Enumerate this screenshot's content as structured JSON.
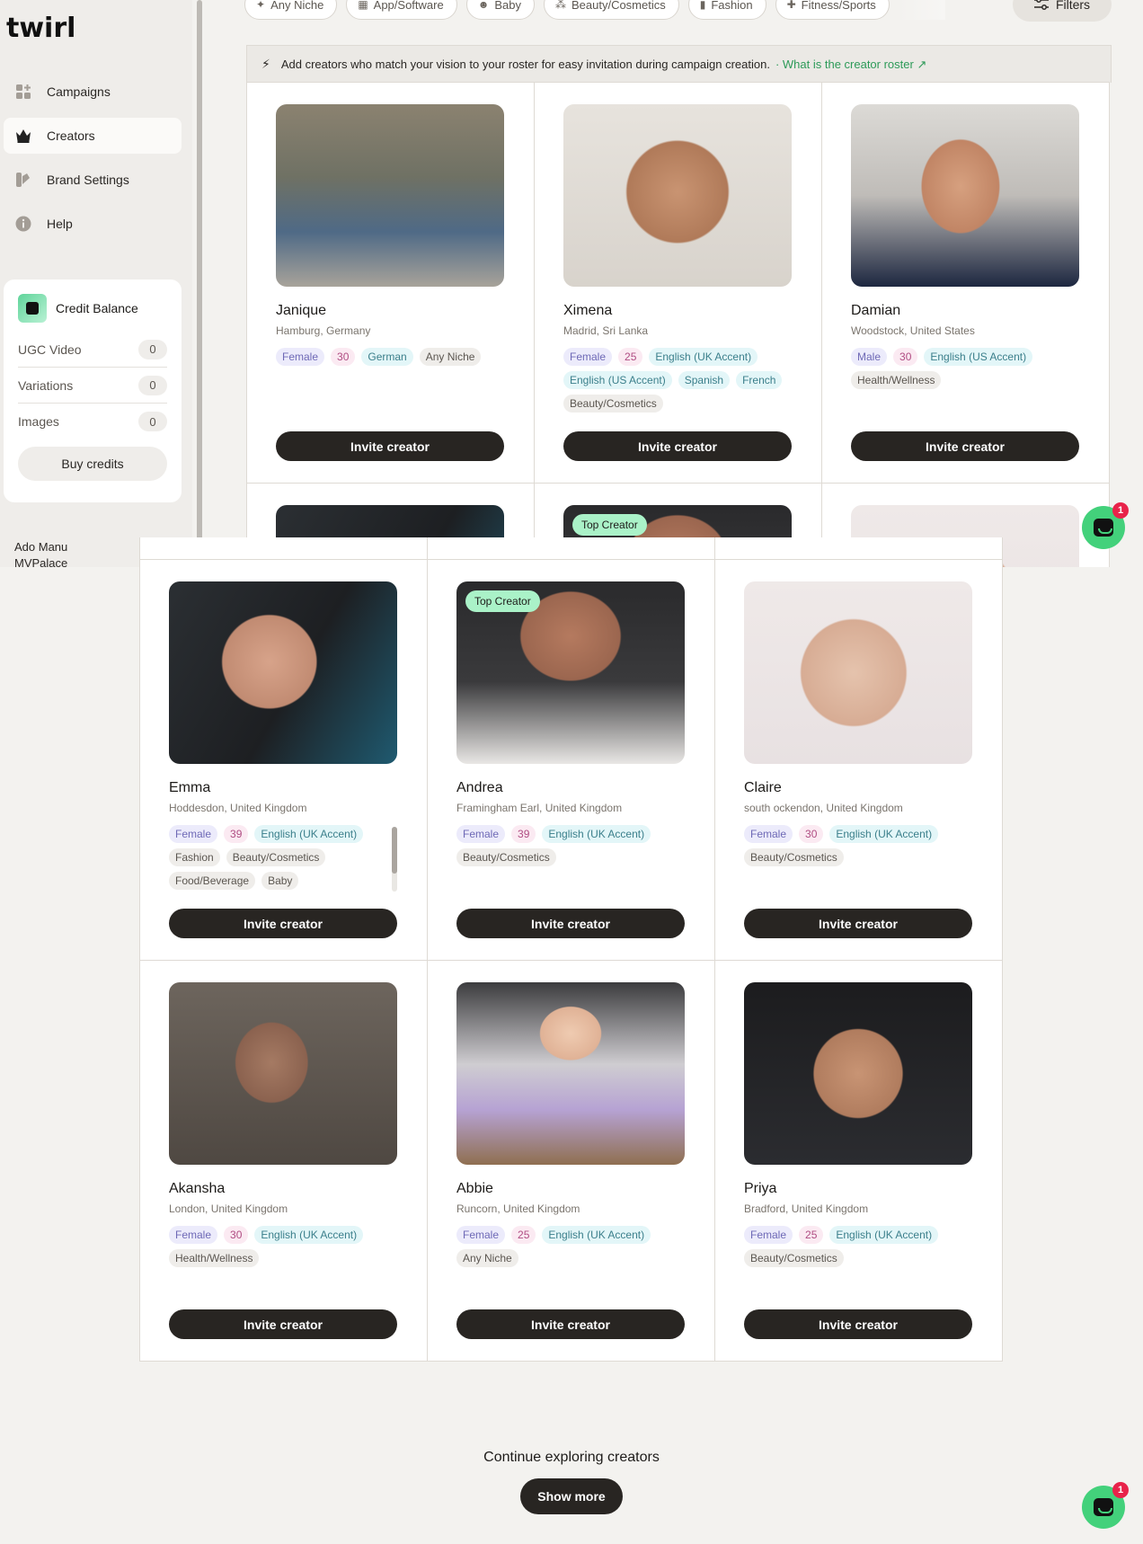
{
  "app": {
    "logo": "twirl"
  },
  "sidebar": {
    "items": [
      {
        "label": "Campaigns",
        "icon": "grid-plus-icon"
      },
      {
        "label": "Creators",
        "icon": "crown-icon"
      },
      {
        "label": "Brand Settings",
        "icon": "palette-icon"
      },
      {
        "label": "Help",
        "icon": "info-icon"
      }
    ],
    "credit": {
      "title": "Credit Balance",
      "rows": [
        {
          "label": "UGC Video",
          "count": "0"
        },
        {
          "label": "Variations",
          "count": "0"
        },
        {
          "label": "Images",
          "count": "0"
        }
      ],
      "buy_label": "Buy credits"
    },
    "user": {
      "name": "Ado Manu",
      "org": "MVPalace"
    }
  },
  "filters": {
    "chips": [
      "Any Niche",
      "App/Software",
      "Baby",
      "Beauty/Cosmetics",
      "Fashion",
      "Fitness/Sports"
    ],
    "filters_label": "Filters"
  },
  "banner": {
    "text": "Add creators who match your vision to your roster for easy invitation during campaign creation.",
    "link": "· What is the creator roster ↗"
  },
  "invite_label": "Invite creator",
  "top_badge": "Top Creator",
  "creators_top": [
    {
      "name": "Janique",
      "location": "Hamburg, Germany",
      "tags": [
        [
          "g",
          "Female"
        ],
        [
          "a",
          "30"
        ],
        [
          "l",
          "German"
        ],
        [
          "n",
          "Any Niche"
        ]
      ]
    },
    {
      "name": "Ximena",
      "location": "Madrid, Sri Lanka",
      "tags": [
        [
          "g",
          "Female"
        ],
        [
          "a",
          "25"
        ],
        [
          "l",
          "English (UK Accent)"
        ],
        [
          "l",
          "English (US Accent)"
        ],
        [
          "l",
          "Spanish"
        ],
        [
          "l",
          "French"
        ],
        [
          "n",
          "Beauty/Cosmetics"
        ]
      ]
    },
    {
      "name": "Damian",
      "location": "Woodstock, United States",
      "tags": [
        [
          "g",
          "Male"
        ],
        [
          "a",
          "30"
        ],
        [
          "l",
          "English (US Accent)"
        ],
        [
          "n",
          "Health/Wellness"
        ]
      ]
    }
  ],
  "creators": [
    {
      "name": "Emma",
      "location": "Hoddesdon, United Kingdom",
      "tags": [
        [
          "g",
          "Female"
        ],
        [
          "a",
          "39"
        ],
        [
          "l",
          "English (UK Accent)"
        ],
        [
          "n",
          "Fashion"
        ],
        [
          "n",
          "Beauty/Cosmetics"
        ],
        [
          "n",
          "Food/Beverage"
        ],
        [
          "n",
          "Baby"
        ]
      ]
    },
    {
      "name": "Andrea",
      "location": "Framingham Earl, United Kingdom",
      "tags": [
        [
          "g",
          "Female"
        ],
        [
          "a",
          "39"
        ],
        [
          "l",
          "English (UK Accent)"
        ],
        [
          "n",
          "Beauty/Cosmetics"
        ]
      ]
    },
    {
      "name": "Claire",
      "location": "south ockendon, United Kingdom",
      "tags": [
        [
          "g",
          "Female"
        ],
        [
          "a",
          "30"
        ],
        [
          "l",
          "English (UK Accent)"
        ],
        [
          "n",
          "Beauty/Cosmetics"
        ]
      ]
    },
    {
      "name": "Akansha",
      "location": "London, United Kingdom",
      "tags": [
        [
          "g",
          "Female"
        ],
        [
          "a",
          "30"
        ],
        [
          "l",
          "English (UK Accent)"
        ],
        [
          "n",
          "Health/Wellness"
        ]
      ]
    },
    {
      "name": "Abbie",
      "location": "Runcorn, United Kingdom",
      "tags": [
        [
          "g",
          "Female"
        ],
        [
          "a",
          "25"
        ],
        [
          "l",
          "English (UK Accent)"
        ],
        [
          "n",
          "Any Niche"
        ]
      ]
    },
    {
      "name": "Priya",
      "location": "Bradford, United Kingdom",
      "tags": [
        [
          "g",
          "Female"
        ],
        [
          "a",
          "25"
        ],
        [
          "l",
          "English (UK Accent)"
        ],
        [
          "n",
          "Beauty/Cosmetics"
        ]
      ]
    }
  ],
  "chat_badge": "1",
  "footer": {
    "continue_text": "Continue exploring creators",
    "show_more": "Show more"
  },
  "colors": {
    "accent_green": "#43d17b",
    "link_green": "#2d9a58",
    "button_dark": "#282522"
  }
}
